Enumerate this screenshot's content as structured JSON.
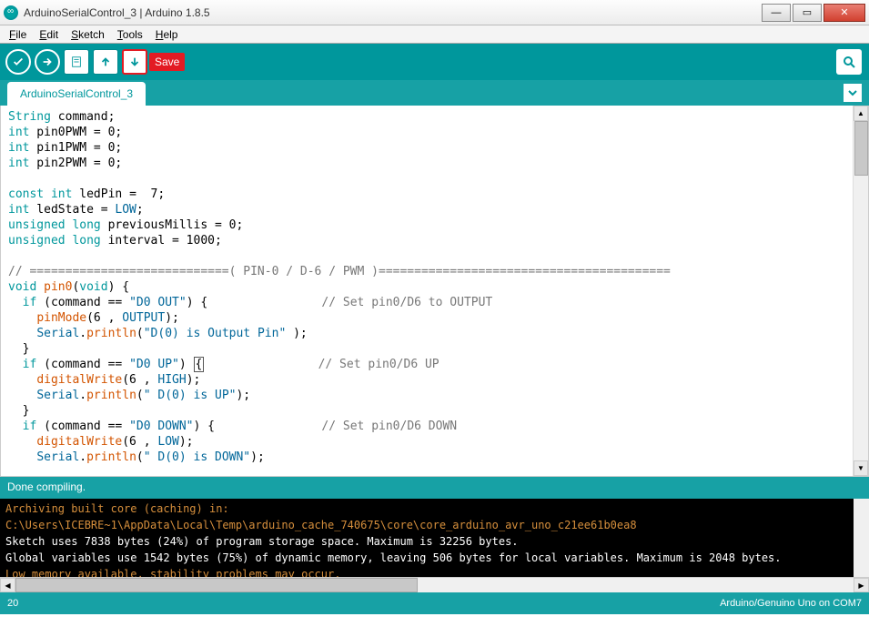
{
  "window": {
    "title": "ArduinoSerialControl_3 | Arduino 1.8.5",
    "min": "—",
    "max": "▭",
    "close": "✕"
  },
  "menu": {
    "file": "File",
    "edit": "Edit",
    "sketch": "Sketch",
    "tools": "Tools",
    "help": "Help"
  },
  "toolbar": {
    "save_label": "Save"
  },
  "tab": {
    "name": "ArduinoSerialControl_3"
  },
  "code": {
    "lines": [
      {
        "t": "decl",
        "parts": [
          [
            "type",
            "String"
          ],
          [
            "",
            " command;"
          ]
        ]
      },
      {
        "t": "decl",
        "parts": [
          [
            "type",
            "int"
          ],
          [
            "",
            " pin0PWM = 0;"
          ]
        ]
      },
      {
        "t": "decl",
        "parts": [
          [
            "type",
            "int"
          ],
          [
            "",
            " pin1PWM = 0;"
          ]
        ]
      },
      {
        "t": "decl",
        "parts": [
          [
            "type",
            "int"
          ],
          [
            "",
            " pin2PWM = 0;"
          ]
        ]
      },
      {
        "t": "blank"
      },
      {
        "t": "decl",
        "parts": [
          [
            "type",
            "const int"
          ],
          [
            "",
            " ledPin =  7;"
          ]
        ]
      },
      {
        "t": "decl",
        "parts": [
          [
            "type",
            "int"
          ],
          [
            "",
            " ledState = "
          ],
          [
            "const",
            "LOW"
          ],
          [
            "",
            ";"
          ]
        ]
      },
      {
        "t": "decl",
        "parts": [
          [
            "type",
            "unsigned long"
          ],
          [
            "",
            " previousMillis = 0;"
          ]
        ]
      },
      {
        "t": "decl",
        "parts": [
          [
            "type",
            "unsigned long"
          ],
          [
            "",
            " interval = 1000;"
          ]
        ]
      },
      {
        "t": "blank"
      },
      {
        "t": "comment",
        "text": "// ============================( PIN-0 / D-6 / PWM )========================================="
      },
      {
        "t": "func",
        "parts": [
          [
            "type",
            "void"
          ],
          [
            "",
            " "
          ],
          [
            "func",
            "pin0"
          ],
          [
            "",
            "("
          ],
          [
            "type",
            "void"
          ],
          [
            "",
            ") {"
          ]
        ]
      },
      {
        "t": "body",
        "parts": [
          [
            "",
            "  "
          ],
          [
            "kw",
            "if"
          ],
          [
            "",
            " (command == "
          ],
          [
            "str",
            "\"D0 OUT\""
          ],
          [
            "",
            ") {                "
          ],
          [
            "comment",
            "// Set pin0/D6 to OUTPUT"
          ]
        ]
      },
      {
        "t": "body",
        "parts": [
          [
            "",
            "    "
          ],
          [
            "func",
            "pinMode"
          ],
          [
            "",
            "(6 , "
          ],
          [
            "const",
            "OUTPUT"
          ],
          [
            "",
            ");"
          ]
        ]
      },
      {
        "t": "body",
        "parts": [
          [
            "",
            "    "
          ],
          [
            "const",
            "Serial"
          ],
          [
            "",
            "."
          ],
          [
            "func",
            "println"
          ],
          [
            "",
            "("
          ],
          [
            "str",
            "\"D(0) is Output Pin\""
          ],
          [
            "",
            " );"
          ]
        ]
      },
      {
        "t": "body",
        "parts": [
          [
            "",
            "  }"
          ]
        ]
      },
      {
        "t": "body",
        "parts": [
          [
            "",
            "  "
          ],
          [
            "kw",
            "if"
          ],
          [
            "",
            " (command == "
          ],
          [
            "str",
            "\"D0 UP\""
          ],
          [
            "",
            ") "
          ],
          [
            "cursor",
            "{"
          ],
          [
            "",
            "                "
          ],
          [
            "comment",
            "// Set pin0/D6 UP"
          ]
        ]
      },
      {
        "t": "body",
        "parts": [
          [
            "",
            "    "
          ],
          [
            "func",
            "digitalWrite"
          ],
          [
            "",
            "(6 , "
          ],
          [
            "const",
            "HIGH"
          ],
          [
            "",
            ");"
          ]
        ]
      },
      {
        "t": "body",
        "parts": [
          [
            "",
            "    "
          ],
          [
            "const",
            "Serial"
          ],
          [
            "",
            "."
          ],
          [
            "func",
            "println"
          ],
          [
            "",
            "("
          ],
          [
            "str",
            "\" D(0) is UP\""
          ],
          [
            "",
            ");"
          ]
        ]
      },
      {
        "t": "body",
        "parts": [
          [
            "",
            "  }"
          ]
        ]
      },
      {
        "t": "body",
        "parts": [
          [
            "",
            "  "
          ],
          [
            "kw",
            "if"
          ],
          [
            "",
            " (command == "
          ],
          [
            "str",
            "\"D0 DOWN\""
          ],
          [
            "",
            ") {               "
          ],
          [
            "comment",
            "// Set pin0/D6 DOWN"
          ]
        ]
      },
      {
        "t": "body",
        "parts": [
          [
            "",
            "    "
          ],
          [
            "func",
            "digitalWrite"
          ],
          [
            "",
            "(6 , "
          ],
          [
            "const",
            "LOW"
          ],
          [
            "",
            ");"
          ]
        ]
      },
      {
        "t": "body",
        "parts": [
          [
            "",
            "    "
          ],
          [
            "const",
            "Serial"
          ],
          [
            "",
            "."
          ],
          [
            "func",
            "println"
          ],
          [
            "",
            "("
          ],
          [
            "str",
            "\" D(0) is DOWN\""
          ],
          [
            "",
            ");"
          ]
        ]
      }
    ]
  },
  "status": {
    "compile": "Done compiling."
  },
  "console": {
    "l1": "Archiving built core (caching) in: C:\\Users\\ICEBRE~1\\AppData\\Local\\Temp\\arduino_cache_740675\\core\\core_arduino_avr_uno_c21ee61b0ea8",
    "l2": "Sketch uses 7838 bytes (24%) of program storage space. Maximum is 32256 bytes.",
    "l3": "Global variables use 1542 bytes (75%) of dynamic memory, leaving 506 bytes for local variables. Maximum is 2048 bytes.",
    "l4": "Low memory available, stability problems may occur."
  },
  "footer": {
    "line": "20",
    "board": "Arduino/Genuino Uno on COM7"
  }
}
